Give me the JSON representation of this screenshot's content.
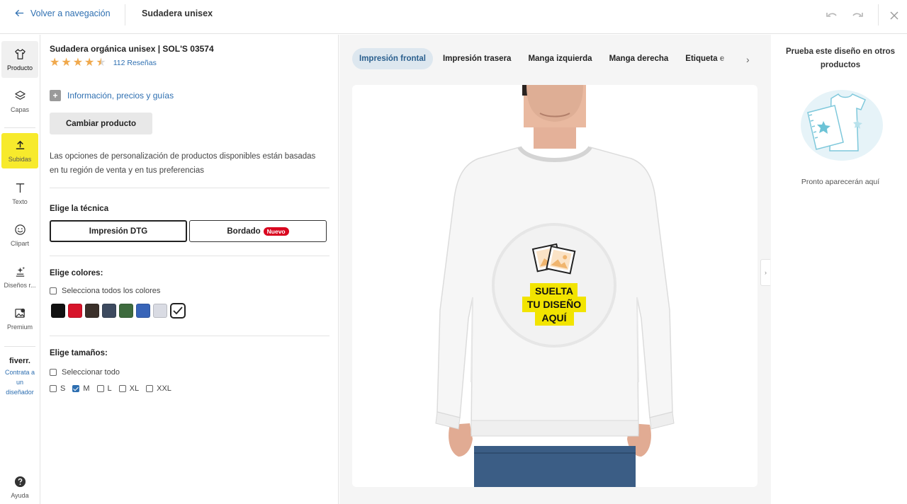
{
  "topbar": {
    "back_label": "Volver a navegación",
    "title": "Sudadera unisex"
  },
  "rail": {
    "items": [
      {
        "label": "Producto",
        "icon": "shirt-icon"
      },
      {
        "label": "Capas",
        "icon": "layers-icon"
      },
      {
        "label": "Subidas",
        "icon": "upload-icon"
      },
      {
        "label": "Texto",
        "icon": "text-icon"
      },
      {
        "label": "Clipart",
        "icon": "smiley-icon"
      },
      {
        "label": "Diseños r...",
        "icon": "sparkle-icon"
      },
      {
        "label": "Premium",
        "icon": "premium-image-icon"
      }
    ],
    "fiverr": {
      "logo": "fiverr.",
      "l1": "Contrata a",
      "l2": "un",
      "l3": "diseñador"
    },
    "help_label": "Ayuda"
  },
  "product": {
    "title": "Sudadera orgánica unisex | SOL'S 03574",
    "rating": 4.5,
    "reviews": "112 Reseñas",
    "info_link": "Información, precios y guías",
    "change_button": "Cambiar producto",
    "description": "Las opciones de personalización de productos disponibles están basadas en tu región de venta y en tus preferencias"
  },
  "technique": {
    "title": "Elige la técnica",
    "options": [
      "Impresión DTG",
      "Bordado"
    ],
    "selected": "Impresión DTG",
    "badge": "Nuevo"
  },
  "colors": {
    "title": "Elige colores:",
    "select_all": "Selecciona todos los colores",
    "swatches": [
      "#111111",
      "#d7142a",
      "#3b302a",
      "#3d4a5f",
      "#3e6b3e",
      "#3864b8",
      "#d9dbe3",
      "#ffffff"
    ],
    "selected_index": 7
  },
  "sizes": {
    "title": "Elige tamaños:",
    "select_all": "Seleccionar todo",
    "options": [
      {
        "label": "S",
        "checked": false
      },
      {
        "label": "M",
        "checked": true
      },
      {
        "label": "L",
        "checked": false
      },
      {
        "label": "XL",
        "checked": false
      },
      {
        "label": "XXL",
        "checked": false
      }
    ]
  },
  "center": {
    "tabs": [
      "Impresión frontal",
      "Impresión trasera",
      "Manga izquierda",
      "Manga derecha",
      "Etiqueta e"
    ],
    "active_tab": "Impresión frontal",
    "drop_line1": "SUELTA",
    "drop_line2": "TU DISEÑO",
    "drop_line3": "AQUÍ"
  },
  "right": {
    "title": "Prueba este diseño en otros productos",
    "note": "Pronto aparecerán aquí"
  },
  "colors_ui": {
    "accent": "#2e6fb1",
    "highlight": "#f7ea2c",
    "drop_yellow": "#f2e400",
    "star": "#f0a94d",
    "badge_red": "#d9061f"
  }
}
